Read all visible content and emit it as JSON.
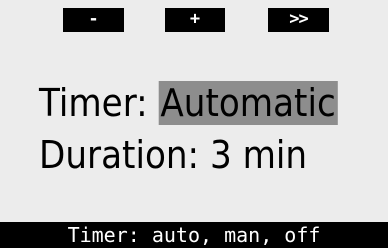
{
  "softkeys": {
    "minus_label": "-",
    "plus_label": "+",
    "next_label": ">>"
  },
  "settings": {
    "timer_label": "Timer:",
    "timer_value": "Automatic",
    "duration_label": "Duration:",
    "duration_value": "3 min"
  },
  "hint": {
    "text": "Timer: auto, man, off"
  },
  "colors": {
    "background": "#ececec",
    "softkey_bg": "#000000",
    "selected_highlight": "#8d8d8d",
    "hint_bar_bg": "#000000"
  }
}
